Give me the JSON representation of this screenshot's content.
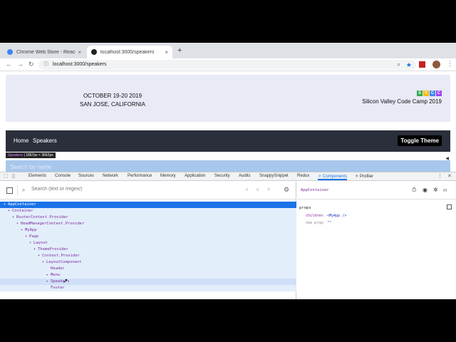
{
  "browser": {
    "tabs": [
      {
        "title": "Chrome Web Store - React Dev",
        "active": false,
        "favicon_color": "#4285f4"
      },
      {
        "title": "localhost:3000/speakers",
        "active": true,
        "favicon_color": "#202124"
      }
    ],
    "close_glyph": "×",
    "new_tab_glyph": "+",
    "url": "localhost:3000/speakers",
    "back_glyph": "←",
    "forward_glyph": "→",
    "reload_glyph": "↻",
    "menu_glyph": "⋮"
  },
  "page": {
    "event": {
      "date_line": "OCTOBER 19-20  2019",
      "location_line": "SAN JOSE, CALIFORNIA"
    },
    "logo_letters": [
      {
        "letter": "S",
        "color": "#34a853"
      },
      {
        "letter": "V",
        "color": "#fbbc05"
      },
      {
        "letter": "C",
        "color": "#4285f4"
      },
      {
        "letter": "C",
        "color": "#a142f4"
      }
    ],
    "conference_title": "Silicon Valley Code Camp 2019",
    "nav": {
      "home": "Home",
      "speakers": "Speakers",
      "toggle_theme": "Toggle Theme"
    },
    "inspect_tip": {
      "name": "Speakers",
      "size": "1867px × 3662px"
    },
    "search_placeholder": "Search by name"
  },
  "devtools": {
    "tabs": [
      "Elements",
      "Console",
      "Sources",
      "Network",
      "Performance",
      "Memory",
      "Application",
      "Security",
      "Audits",
      "SnappySnippet",
      "Redux",
      "⚛ Components",
      "⚛ Profiler"
    ],
    "active_tab": "⚛ Components",
    "search_placeholder": "Search (text or /regex/)",
    "tree": [
      {
        "name": "AppContainer",
        "depth": 0,
        "arrow": "▾",
        "state": "selected"
      },
      {
        "name": "Container",
        "depth": 1,
        "arrow": "▾",
        "state": "band"
      },
      {
        "name": "RouterContext.Provider",
        "depth": 2,
        "arrow": "▾",
        "state": "band"
      },
      {
        "name": "HeadManagerContext.Provider",
        "depth": 3,
        "arrow": "▾",
        "state": "band"
      },
      {
        "name": "MyApp",
        "depth": 4,
        "arrow": "▾",
        "state": "band"
      },
      {
        "name": "Page",
        "depth": 5,
        "arrow": "▾",
        "state": "band"
      },
      {
        "name": "Layout",
        "depth": 6,
        "arrow": "▾",
        "state": "band"
      },
      {
        "name": "ThemeProvider",
        "depth": 7,
        "arrow": "▾",
        "state": "band"
      },
      {
        "name": "Context.Provider",
        "depth": 8,
        "arrow": "▾",
        "state": "band"
      },
      {
        "name": "LayoutComponent",
        "depth": 9,
        "arrow": "▾",
        "state": "band"
      },
      {
        "name": "Header",
        "depth": 10,
        "arrow": "",
        "state": "band"
      },
      {
        "name": "Menu",
        "depth": 10,
        "arrow": "▸",
        "state": "band"
      },
      {
        "name": "Speakers",
        "depth": 10,
        "arrow": "▸",
        "state": "hover"
      },
      {
        "name": "Footer",
        "depth": 10,
        "arrow": "",
        "state": "band"
      }
    ],
    "selected_component": "AppContainer",
    "props_label": "props",
    "props": [
      {
        "key": "children",
        "value": "<MyApp />"
      },
      {
        "key": "new prop",
        "value": "\"\""
      }
    ]
  }
}
